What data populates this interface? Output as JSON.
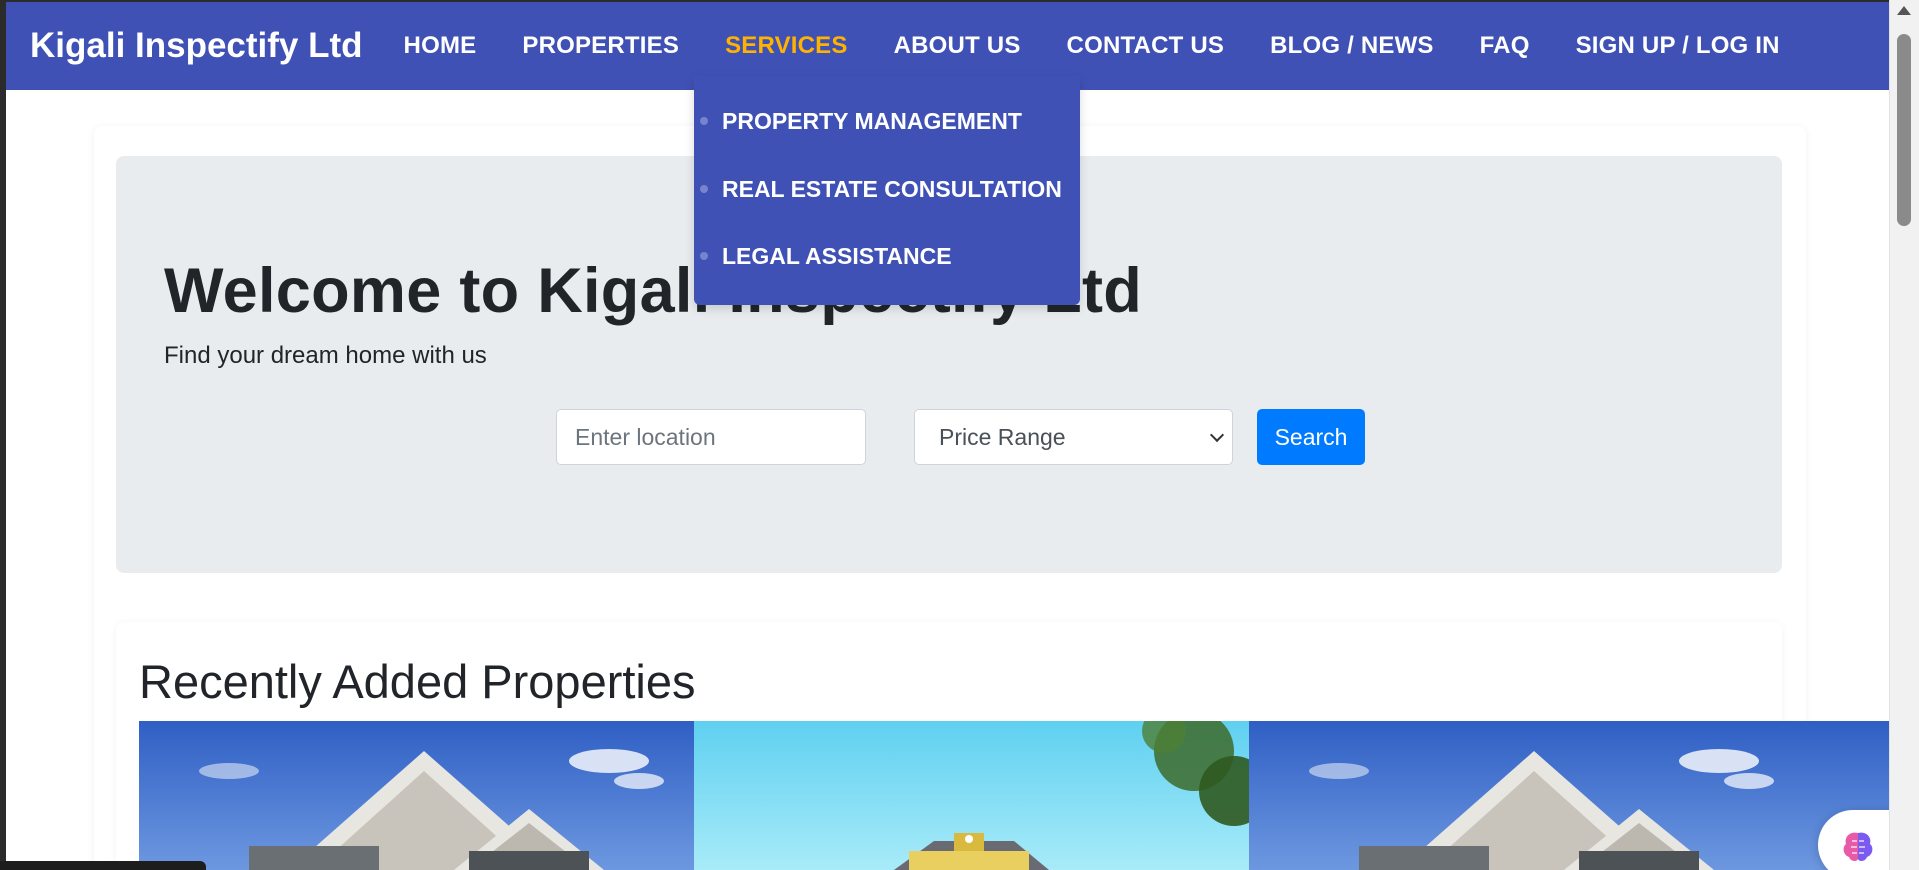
{
  "brand": "Kigali Inspectify Ltd",
  "nav": {
    "items": [
      {
        "label": "HOME"
      },
      {
        "label": "PROPERTIES"
      },
      {
        "label": "SERVICES"
      },
      {
        "label": "ABOUT US"
      },
      {
        "label": "CONTACT US"
      },
      {
        "label": "BLOG / NEWS"
      },
      {
        "label": "FAQ"
      },
      {
        "label": "SIGN UP / LOG IN"
      }
    ],
    "active": "SERVICES"
  },
  "dropdown": {
    "items": [
      {
        "label": "PROPERTY MANAGEMENT"
      },
      {
        "label": "REAL ESTATE CONSULTATION"
      },
      {
        "label": "LEGAL ASSISTANCE"
      }
    ]
  },
  "hero": {
    "title": "Welcome to Kigali Inspectify Ltd",
    "subtitle": "Find your dream home with us"
  },
  "search": {
    "location_placeholder": "Enter location",
    "price_value": "Price Range",
    "button": "Search"
  },
  "properties": {
    "title": "Recently Added Properties"
  },
  "colors": {
    "navbar": "#3f51b5",
    "active_nav": "#ffb300",
    "jumbotron": "#e9ecef",
    "search_button": "#007bff"
  },
  "icons": {
    "assistant": "brain-icon",
    "select": "chevron-down-icon"
  }
}
